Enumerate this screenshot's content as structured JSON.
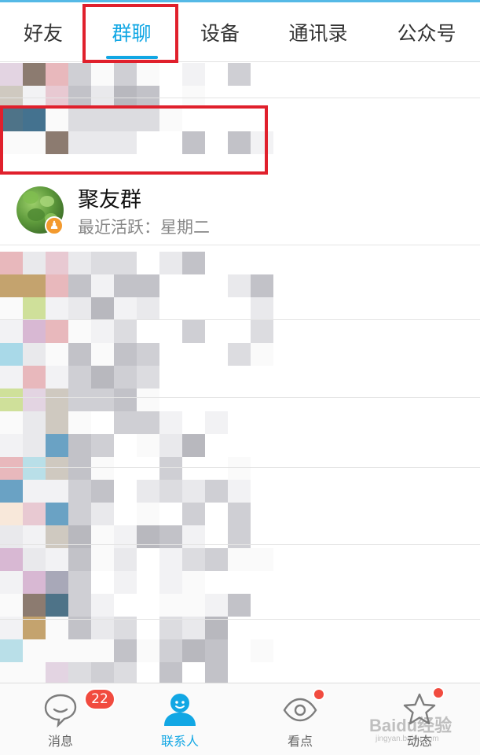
{
  "tabs": [
    {
      "label": "好友"
    },
    {
      "label": "群聊",
      "active": true
    },
    {
      "label": "设备"
    },
    {
      "label": "通讯录"
    },
    {
      "label": "公众号"
    }
  ],
  "group": {
    "name": "聚友群",
    "last_active": "最近活跃：星期二"
  },
  "bottom_nav": {
    "messages_label": "消息",
    "messages_badge": "22",
    "contacts_label": "联系人",
    "watch_label": "看点",
    "moments_label": "动态"
  },
  "colors": {
    "accent": "#12a7e4",
    "highlight_box": "#e0202c",
    "badge": "#f14b3f"
  },
  "watermark": {
    "text": "Baidu经验",
    "sub": "jingyan.baidu.com"
  }
}
